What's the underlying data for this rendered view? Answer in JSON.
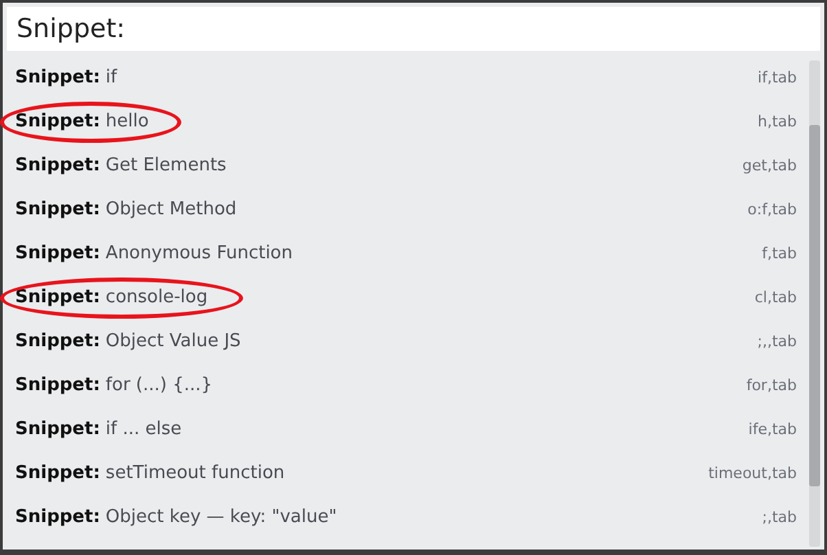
{
  "search": {
    "value": "Snippet:"
  },
  "items": [
    {
      "prefix": "Snippet:",
      "name": "if",
      "shortcut": "if,tab",
      "circled": false
    },
    {
      "prefix": "Snippet:",
      "name": "hello",
      "shortcut": "h,tab",
      "circled": true
    },
    {
      "prefix": "Snippet:",
      "name": "Get Elements",
      "shortcut": "get,tab",
      "circled": false
    },
    {
      "prefix": "Snippet:",
      "name": "Object Method",
      "shortcut": "o:f,tab",
      "circled": false
    },
    {
      "prefix": "Snippet:",
      "name": "Anonymous Function",
      "shortcut": "f,tab",
      "circled": false
    },
    {
      "prefix": "Snippet:",
      "name": "console-log",
      "shortcut": "cl,tab",
      "circled": true
    },
    {
      "prefix": "Snippet:",
      "name": "Object Value JS",
      "shortcut": ";,,tab",
      "circled": false
    },
    {
      "prefix": "Snippet:",
      "name": "for (...) {...}",
      "shortcut": "for,tab",
      "circled": false
    },
    {
      "prefix": "Snippet:",
      "name": "if ... else",
      "shortcut": "ife,tab",
      "circled": false
    },
    {
      "prefix": "Snippet:",
      "name": "setTimeout function",
      "shortcut": "timeout,tab",
      "circled": false
    },
    {
      "prefix": "Snippet:",
      "name": "Object key — key: \"value\"",
      "shortcut": ";,tab",
      "circled": false
    }
  ]
}
